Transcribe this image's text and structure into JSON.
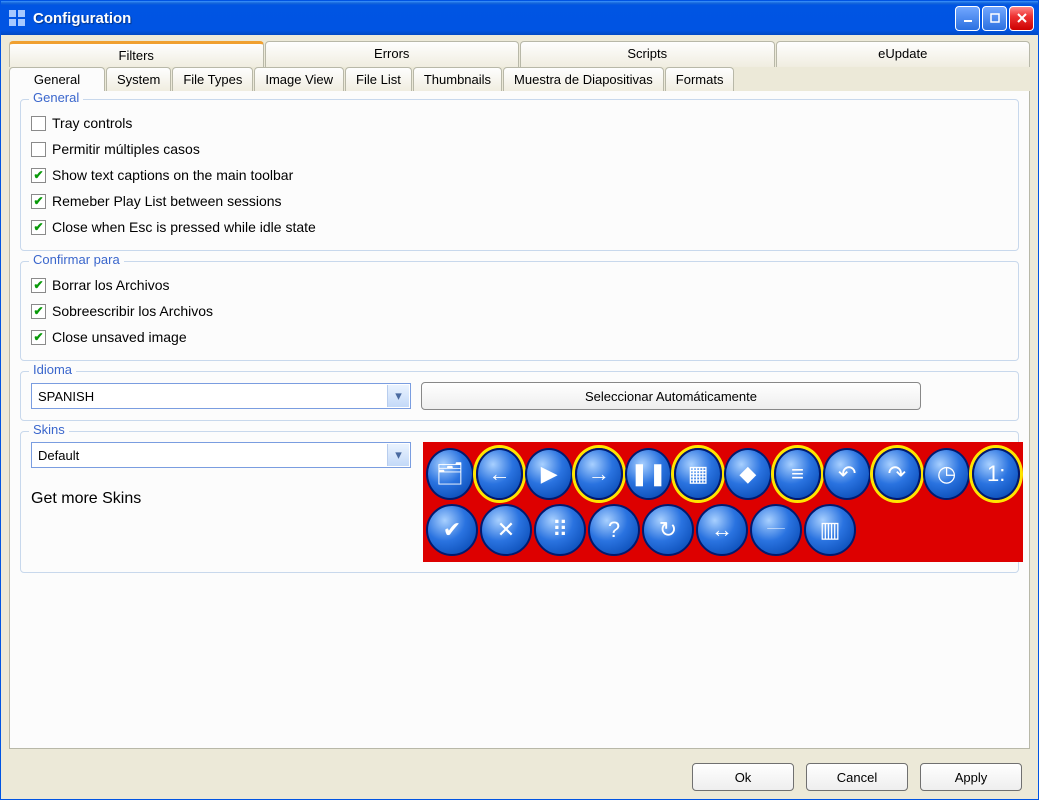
{
  "window": {
    "title": "Configuration"
  },
  "tabs_top": [
    {
      "id": "filters",
      "label": "Filters"
    },
    {
      "id": "errors",
      "label": "Errors"
    },
    {
      "id": "scripts",
      "label": "Scripts"
    },
    {
      "id": "eupdate",
      "label": "eUpdate"
    }
  ],
  "tabs_bottom": [
    {
      "id": "general",
      "label": "General",
      "active": true
    },
    {
      "id": "system",
      "label": "System"
    },
    {
      "id": "filetypes",
      "label": "File Types"
    },
    {
      "id": "imageview",
      "label": "Image View"
    },
    {
      "id": "filelist",
      "label": "File List"
    },
    {
      "id": "thumbnails",
      "label": "Thumbnails"
    },
    {
      "id": "muestra",
      "label": "Muestra de Diapositivas"
    },
    {
      "id": "formats",
      "label": "Formats"
    }
  ],
  "group_general": {
    "legend": "General",
    "items": [
      {
        "label": "Tray controls",
        "checked": false
      },
      {
        "label": "Permitir múltiples casos",
        "checked": false
      },
      {
        "label": "Show text captions on the main toolbar",
        "checked": true
      },
      {
        "label": "Remeber Play List between sessions",
        "checked": true
      },
      {
        "label": "Close when Esc is pressed while idle state",
        "checked": true
      }
    ]
  },
  "group_confirm": {
    "legend": "Confirmar para",
    "items": [
      {
        "label": "Borrar los Archivos",
        "checked": true
      },
      {
        "label": "Sobreescribir los Archivos",
        "checked": true
      },
      {
        "label": "Close unsaved image",
        "checked": true
      }
    ]
  },
  "group_idioma": {
    "legend": "Idioma",
    "value": "SPANISH",
    "auto_button": "Seleccionar Automáticamente"
  },
  "group_skins": {
    "legend": "Skins",
    "value": "Default",
    "link": "Get more Skins",
    "icons": [
      [
        {
          "name": "folders-icon",
          "glyph": "🗂"
        },
        {
          "name": "back-icon",
          "glyph": "←",
          "yellow": true
        },
        {
          "name": "play-icon",
          "glyph": "▶"
        },
        {
          "name": "forward-icon",
          "glyph": "→",
          "yellow": true
        },
        {
          "name": "pause-icon",
          "glyph": "❚❚"
        },
        {
          "name": "grid-icon",
          "glyph": "▦",
          "yellow": true
        },
        {
          "name": "diamond-icon",
          "glyph": "◆"
        },
        {
          "name": "lines-icon",
          "glyph": "≡",
          "yellow": true
        },
        {
          "name": "undo-icon",
          "glyph": "↶"
        },
        {
          "name": "redo-icon",
          "glyph": "↷",
          "yellow": true
        },
        {
          "name": "clock-icon",
          "glyph": "◷"
        },
        {
          "name": "one-one-icon",
          "glyph": "1:",
          "yellow": true
        }
      ],
      [
        {
          "name": "check-icon",
          "glyph": "✔"
        },
        {
          "name": "close-round-icon",
          "glyph": "✕"
        },
        {
          "name": "dots-icon",
          "glyph": "⠿"
        },
        {
          "name": "help-icon",
          "glyph": "?"
        },
        {
          "name": "refresh-icon",
          "glyph": "↻"
        },
        {
          "name": "resize-h-icon",
          "glyph": "↔"
        },
        {
          "name": "bars-thin-icon",
          "glyph": "𝄖"
        },
        {
          "name": "bars-thick-icon",
          "glyph": "▥"
        }
      ]
    ]
  },
  "buttons": {
    "ok": "Ok",
    "cancel": "Cancel",
    "apply": "Apply"
  }
}
